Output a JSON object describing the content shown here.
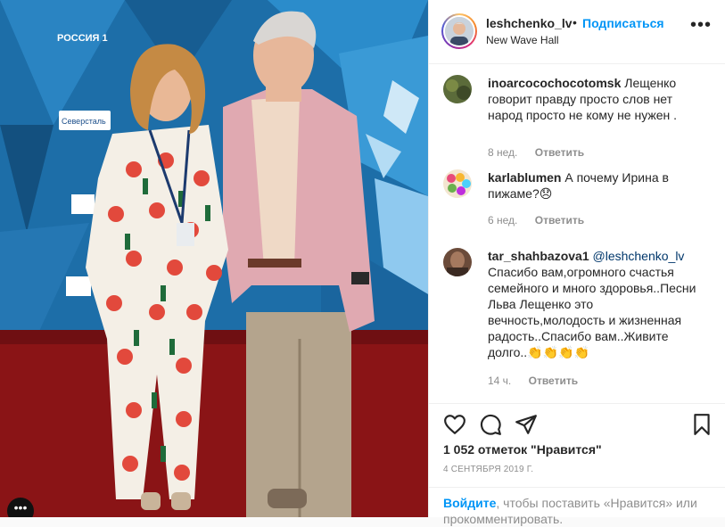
{
  "header": {
    "username": "leshchenko_lv",
    "dot": "•",
    "follow_label": "Подписаться",
    "location": "New Wave Hall",
    "options": "•••"
  },
  "photo": {
    "backdrop_logos": [
      "РОССИЯ 1",
      "Северсталь"
    ],
    "more_glyph": "•••"
  },
  "comments": [
    {
      "username": "inoarcocochocotomsk",
      "text": "Лещенко говорит правду просто слов нет народ просто не кому не нужен .",
      "time": "8 нед.",
      "reply": "Ответить"
    },
    {
      "username": "karlablumen",
      "text": "А почему Ирина в пижаме?😞",
      "time": "6 нед.",
      "reply": "Ответить"
    },
    {
      "username": "tar_shahbazova1",
      "mention": "@leshchenko_lv",
      "text": "Спасибо вам,огромного счастья семейного и много здоровья..Песни Льва Лещенко это вечность,молодость и жизненная радость..Спасибо вам..Живите долго..👏👏👏👏",
      "time": "14 ч.",
      "reply": "Ответить"
    }
  ],
  "actions": {
    "icons": [
      "heart-icon",
      "comment-icon",
      "share-icon",
      "bookmark-icon"
    ],
    "likes": "1 052 отметок \"Нравится\"",
    "date": "4 СЕНТЯБРЯ 2019 Г.",
    "login_link": "Войдите",
    "login_text": ", чтобы поставить «Нравится» или прокомментировать."
  },
  "colors": {
    "accent": "#0095f6",
    "text": "#262626",
    "muted": "#8e8e8e",
    "backdrop": "#1d6ea8",
    "carpet": "#8a1416"
  }
}
